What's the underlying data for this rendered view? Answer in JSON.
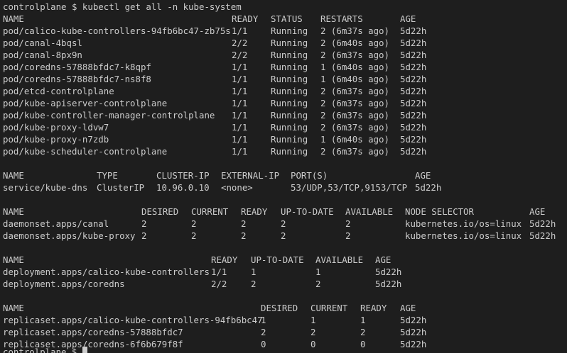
{
  "terminal": {
    "prompt_line": "controlplane $ kubectl get all -n kube-system",
    "last_prompt": "controlplane $"
  },
  "pods": {
    "headers": [
      "NAME",
      "READY",
      "STATUS",
      "RESTARTS",
      "AGE"
    ],
    "rows": [
      [
        "pod/calico-kube-controllers-94fb6bc47-zb75s",
        "1/1",
        "Running",
        "2 (6m37s ago)",
        "5d22h"
      ],
      [
        "pod/canal-4bqsl",
        "2/2",
        "Running",
        "2 (6m40s ago)",
        "5d22h"
      ],
      [
        "pod/canal-8px9n",
        "2/2",
        "Running",
        "2 (6m37s ago)",
        "5d22h"
      ],
      [
        "pod/coredns-57888bfdc7-k8qpf",
        "1/1",
        "Running",
        "1 (6m40s ago)",
        "5d22h"
      ],
      [
        "pod/coredns-57888bfdc7-ns8f8",
        "1/1",
        "Running",
        "1 (6m40s ago)",
        "5d22h"
      ],
      [
        "pod/etcd-controlplane",
        "1/1",
        "Running",
        "2 (6m37s ago)",
        "5d22h"
      ],
      [
        "pod/kube-apiserver-controlplane",
        "1/1",
        "Running",
        "2 (6m37s ago)",
        "5d22h"
      ],
      [
        "pod/kube-controller-manager-controlplane",
        "1/1",
        "Running",
        "2 (6m37s ago)",
        "5d22h"
      ],
      [
        "pod/kube-proxy-ldvw7",
        "1/1",
        "Running",
        "2 (6m37s ago)",
        "5d22h"
      ],
      [
        "pod/kube-proxy-n7zdb",
        "1/1",
        "Running",
        "1 (6m40s ago)",
        "5d22h"
      ],
      [
        "pod/kube-scheduler-controlplane",
        "1/1",
        "Running",
        "2 (6m37s ago)",
        "5d22h"
      ]
    ]
  },
  "services": {
    "headers": [
      "NAME",
      "TYPE",
      "CLUSTER-IP",
      "EXTERNAL-IP",
      "PORT(S)",
      "AGE"
    ],
    "rows": [
      [
        "service/kube-dns",
        "ClusterIP",
        "10.96.0.10",
        "<none>",
        "53/UDP,53/TCP,9153/TCP",
        "5d22h"
      ]
    ]
  },
  "daemonsets": {
    "headers": [
      "NAME",
      "DESIRED",
      "CURRENT",
      "READY",
      "UP-TO-DATE",
      "AVAILABLE",
      "NODE SELECTOR",
      "AGE"
    ],
    "rows": [
      [
        "daemonset.apps/canal",
        "2",
        "2",
        "2",
        "2",
        "2",
        "kubernetes.io/os=linux",
        "5d22h"
      ],
      [
        "daemonset.apps/kube-proxy",
        "2",
        "2",
        "2",
        "2",
        "2",
        "kubernetes.io/os=linux",
        "5d22h"
      ]
    ]
  },
  "deployments": {
    "headers": [
      "NAME",
      "READY",
      "UP-TO-DATE",
      "AVAILABLE",
      "AGE"
    ],
    "rows": [
      [
        "deployment.apps/calico-kube-controllers",
        "1/1",
        "1",
        "1",
        "5d22h"
      ],
      [
        "deployment.apps/coredns",
        "2/2",
        "2",
        "2",
        "5d22h"
      ]
    ]
  },
  "replicasets": {
    "headers": [
      "NAME",
      "DESIRED",
      "CURRENT",
      "READY",
      "AGE"
    ],
    "rows": [
      [
        "replicaset.apps/calico-kube-controllers-94fb6bc47",
        "1",
        "1",
        "1",
        "5d22h"
      ],
      [
        "replicaset.apps/coredns-57888bfdc7",
        "2",
        "2",
        "2",
        "5d22h"
      ],
      [
        "replicaset.apps/coredns-6f6b679f8f",
        "0",
        "0",
        "0",
        "5d22h"
      ]
    ]
  }
}
